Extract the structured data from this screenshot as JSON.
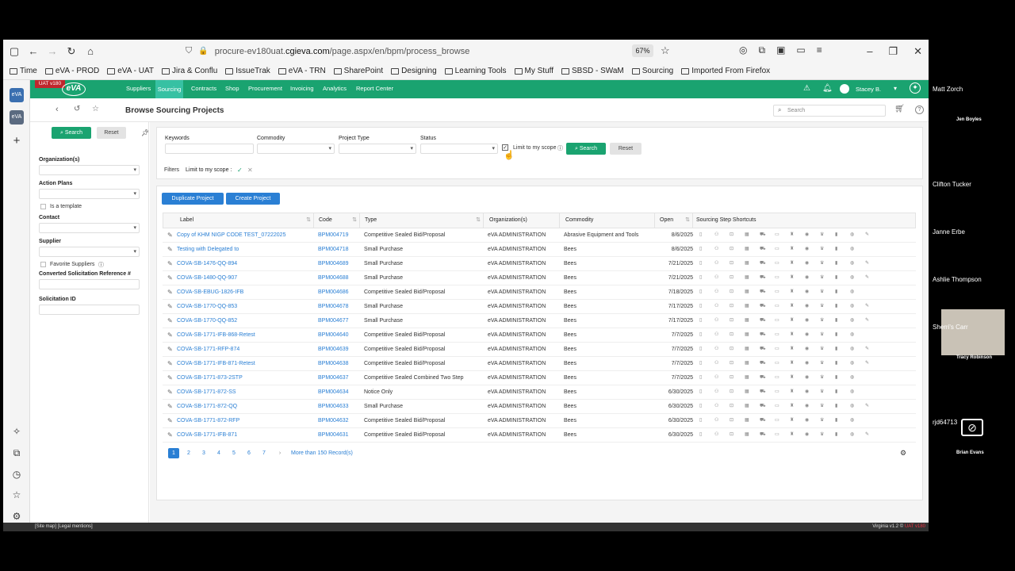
{
  "browser": {
    "url_prefix": "procure-ev180uat.",
    "url_domain": "cgieva.com",
    "url_path": "/page.aspx/en/bpm/process_browse",
    "zoom": "67%"
  },
  "bookmarks": [
    "Time",
    "eVA - PROD",
    "eVA - UAT",
    "Jira & Conflu",
    "IssueTrak",
    "eVA - TRN",
    "SharePoint",
    "Designing",
    "Learning Tools",
    "My Stuff",
    "SBSD - SWaM",
    "Sourcing",
    "Imported From Firefox"
  ],
  "app": {
    "badge": "UAT v180",
    "logo": "eVA",
    "nav": [
      "Suppliers",
      "Sourcing",
      "Contracts",
      "Shop",
      "Procurement",
      "Invoicing",
      "Analytics",
      "Report Center"
    ],
    "user": "Stacey B.",
    "page_title": "Browse Sourcing Projects",
    "search_placeholder": "Search"
  },
  "left_filters": {
    "search_label": "Search",
    "reset_label": "Reset",
    "organizations": "Organization(s)",
    "action_plans": "Action Plans",
    "is_template": "Is a template",
    "contact": "Contact",
    "supplier": "Supplier",
    "favorite_suppliers": "Favorite Suppliers",
    "converted_ref": "Converted Solicitation Reference #",
    "solicitation_id": "Solicitation ID"
  },
  "top_filters": {
    "keywords": "Keywords",
    "commodity": "Commodity",
    "project_type": "Project Type",
    "status": "Status",
    "limit_scope": "Limit to my scope",
    "search": "Search",
    "reset": "Reset",
    "filters_label": "Filters",
    "active_filter": "Limit to my scope :"
  },
  "actions": {
    "duplicate": "Duplicate Project",
    "create": "Create Project"
  },
  "table": {
    "headers": [
      "Label",
      "Code",
      "Type",
      "Organization(s)",
      "Commodity",
      "Open",
      "Sourcing Step Shortcuts"
    ],
    "rows": [
      [
        "Copy of KHM NIGP CODE TEST_07222025",
        "BPM004719",
        "Competitive Sealed Bid/Proposal",
        "eVA ADMINISTRATION",
        "Abrasive Equipment and Tools",
        "8/6/2025"
      ],
      [
        "Testing with Delegated to",
        "BPM004718",
        "Small Purchase",
        "eVA ADMINISTRATION",
        "Bees",
        "8/6/2025"
      ],
      [
        "COVA-SB-1476-QQ-894",
        "BPM004689",
        "Small Purchase",
        "eVA ADMINISTRATION",
        "Bees",
        "7/21/2025"
      ],
      [
        "COVA-SB-1480-QQ-907",
        "BPM004688",
        "Small Purchase",
        "eVA ADMINISTRATION",
        "Bees",
        "7/21/2025"
      ],
      [
        "COVA-SB-EBUG-1826-IFB",
        "BPM004686",
        "Competitive Sealed Bid/Proposal",
        "eVA ADMINISTRATION",
        "Bees",
        "7/18/2025"
      ],
      [
        "COVA-SB-1770-QQ-853",
        "BPM004678",
        "Small Purchase",
        "eVA ADMINISTRATION",
        "Bees",
        "7/17/2025"
      ],
      [
        "COVA-SB-1770-QQ-852",
        "BPM004677",
        "Small Purchase",
        "eVA ADMINISTRATION",
        "Bees",
        "7/17/2025"
      ],
      [
        "COVA-SB-1771-IFB-868-Retest",
        "BPM004640",
        "Competitive Sealed Bid/Proposal",
        "eVA ADMINISTRATION",
        "Bees",
        "7/7/2025"
      ],
      [
        "COVA-SB-1771-RFP-874",
        "BPM004639",
        "Competitive Sealed Bid/Proposal",
        "eVA ADMINISTRATION",
        "Bees",
        "7/7/2025"
      ],
      [
        "COVA-SB-1771-IFB-871-Retest",
        "BPM004638",
        "Competitive Sealed Bid/Proposal",
        "eVA ADMINISTRATION",
        "Bees",
        "7/7/2025"
      ],
      [
        "COVA-SB-1771-873-2STP",
        "BPM004637",
        "Competitive Sealed Combined Two Step",
        "eVA ADMINISTRATION",
        "Bees",
        "7/7/2025"
      ],
      [
        "COVA-SB-1771-872-SS",
        "BPM004634",
        "Notice Only",
        "eVA ADMINISTRATION",
        "Bees",
        "6/30/2025"
      ],
      [
        "COVA-SB-1771-872-QQ",
        "BPM004633",
        "Small Purchase",
        "eVA ADMINISTRATION",
        "Bees",
        "6/30/2025"
      ],
      [
        "COVA-SB-1771-872-RFP",
        "BPM004632",
        "Competitive Sealed Bid/Proposal",
        "eVA ADMINISTRATION",
        "Bees",
        "6/30/2025"
      ],
      [
        "COVA-SB-1771-IFB-871",
        "BPM004631",
        "Competitive Sealed Bid/Proposal",
        "eVA ADMINISTRATION",
        "Bees",
        "6/30/2025"
      ]
    ]
  },
  "pagination": {
    "pages": [
      "1",
      "2",
      "3",
      "4",
      "5",
      "6",
      "7"
    ],
    "next": "›",
    "more": "More than 150 Record(s)"
  },
  "footer": {
    "left": "[Site map] [Legal mentions]",
    "right_prefix": "Virginia v1.2 © ",
    "right_suffix": "UAT v180"
  },
  "participants": [
    "Matt Zorch",
    "Jen Boyles",
    "Clifton Tucker",
    "Janne Erbe",
    "Ashlie Thompson",
    "Sherri's Carr",
    "Tracy Robinson",
    "rjd64713",
    "Brian Evans"
  ],
  "colors": {
    "brand": "#1aa370",
    "active_nav": "#37c1a3",
    "link": "#2a7fd4"
  }
}
